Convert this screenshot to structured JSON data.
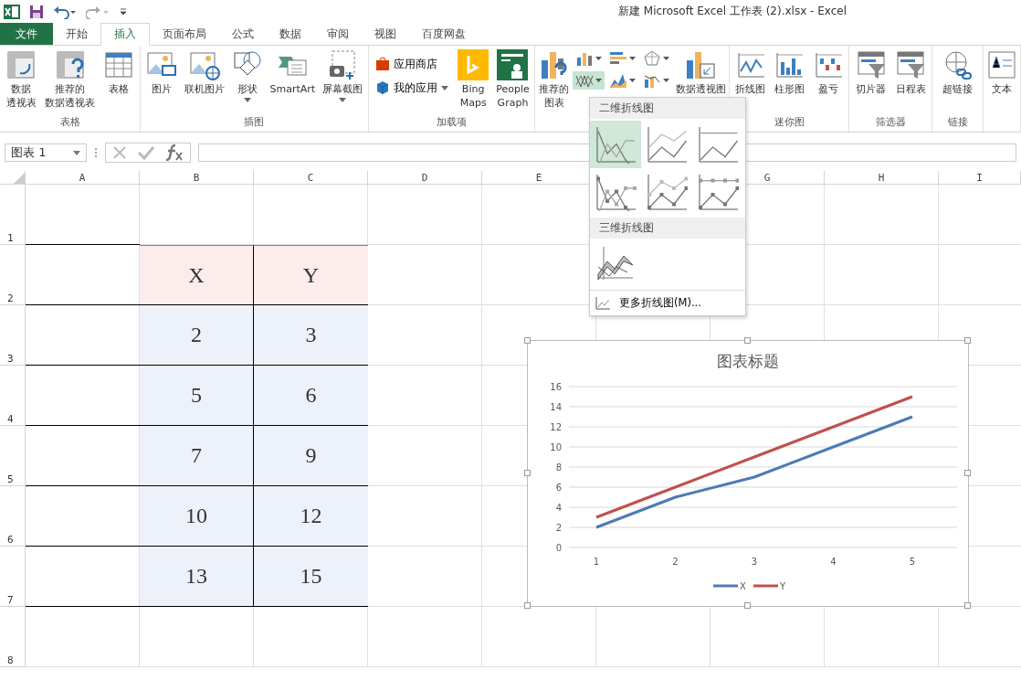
{
  "window": {
    "title": "新建 Microsoft Excel 工作表 (2).xlsx - Excel"
  },
  "tabs": [
    {
      "label": "文件",
      "kind": "file",
      "selected": false
    },
    {
      "label": "开始",
      "kind": "tab",
      "selected": false
    },
    {
      "label": "插入",
      "kind": "tab",
      "selected": true
    },
    {
      "label": "页面布局",
      "kind": "tab",
      "selected": false
    },
    {
      "label": "公式",
      "kind": "tab",
      "selected": false
    },
    {
      "label": "数据",
      "kind": "tab",
      "selected": false
    },
    {
      "label": "审阅",
      "kind": "tab",
      "selected": false
    },
    {
      "label": "视图",
      "kind": "tab",
      "selected": false
    },
    {
      "label": "百度网盘",
      "kind": "tab",
      "selected": false
    }
  ],
  "ribbon_groups": [
    {
      "label": "表格",
      "buttons": [
        {
          "lines": [
            "数据",
            "透视表"
          ]
        },
        {
          "lines": [
            "推荐的",
            "数据透视表"
          ]
        },
        {
          "lines": [
            "表格"
          ]
        }
      ]
    },
    {
      "label": "插图",
      "buttons": [
        {
          "lines": [
            "图片"
          ]
        },
        {
          "lines": [
            "联机图片"
          ]
        },
        {
          "lines": [
            "形状"
          ],
          "dropdown": true
        },
        {
          "lines": [
            "SmartArt"
          ]
        },
        {
          "lines": [
            "屏幕截图"
          ],
          "dropdown": true
        }
      ]
    },
    {
      "label": "加载项",
      "small_buttons": [
        {
          "label": "应用商店",
          "dropdown": false
        },
        {
          "label": "我的应用",
          "dropdown": true
        }
      ],
      "buttons": [
        {
          "lines": [
            "Bing",
            "Maps"
          ]
        },
        {
          "lines": [
            "People",
            "Graph"
          ]
        }
      ]
    },
    {
      "buttons": [
        {
          "lines": [
            "推荐的",
            "图表"
          ]
        }
      ],
      "chart_buttons": [
        {
          "selected": false
        },
        {
          "selected": false
        },
        {
          "selected": false
        },
        {
          "selected": true
        },
        {
          "selected": false
        },
        {
          "selected": false
        }
      ],
      "after_buttons": [
        {
          "lines": [
            "数据透视图"
          ]
        }
      ]
    },
    {
      "label": "迷你图",
      "buttons": [
        {
          "lines": [
            "折线图"
          ]
        },
        {
          "lines": [
            "柱形图"
          ]
        },
        {
          "lines": [
            "盈亏"
          ]
        }
      ]
    },
    {
      "label": "筛选器",
      "buttons": [
        {
          "lines": [
            "切片器"
          ]
        },
        {
          "lines": [
            "日程表"
          ]
        }
      ]
    },
    {
      "label": "链接",
      "buttons": [
        {
          "lines": [
            "超链接"
          ]
        }
      ]
    },
    {
      "buttons": [
        {
          "lines": [
            "文本"
          ]
        }
      ]
    }
  ],
  "name_box": {
    "value": "图表 1"
  },
  "columns": [
    "A",
    "B",
    "C",
    "D",
    "E",
    null,
    "G",
    "H",
    "I"
  ],
  "rows": [
    "1",
    "2",
    "3",
    "4",
    "5",
    "6",
    "7",
    "8"
  ],
  "table": {
    "header": [
      "X",
      "Y"
    ],
    "rows": [
      [
        "2",
        "3"
      ],
      [
        "5",
        "6"
      ],
      [
        "7",
        "9"
      ],
      [
        "10",
        "12"
      ],
      [
        "13",
        "15"
      ]
    ]
  },
  "chart": {
    "chart_data": {
      "type": "line",
      "title": "图表标题",
      "categories": [
        "1",
        "2",
        "3",
        "4",
        "5"
      ],
      "series": [
        {
          "name": "X",
          "color": "#4e7ab5",
          "values": [
            2,
            5,
            7,
            10,
            13
          ]
        },
        {
          "name": "Y",
          "color": "#c0504d",
          "values": [
            3,
            6,
            9,
            12,
            15
          ]
        }
      ],
      "ylim": [
        0,
        16
      ],
      "yticks": [
        0,
        2,
        4,
        6,
        8,
        10,
        12,
        14,
        16
      ],
      "grid": true,
      "legend": "bottom"
    }
  },
  "line_menu": {
    "sections": [
      {
        "title": "二维折线图",
        "items": [
          {
            "selected": true
          },
          {
            "selected": false
          },
          {
            "selected": false
          },
          {
            "selected": false
          },
          {
            "selected": false
          },
          {
            "selected": false
          }
        ]
      },
      {
        "title": "三维折线图",
        "items": [
          {
            "selected": false
          }
        ]
      }
    ],
    "footer": "更多折线图(M)..."
  }
}
